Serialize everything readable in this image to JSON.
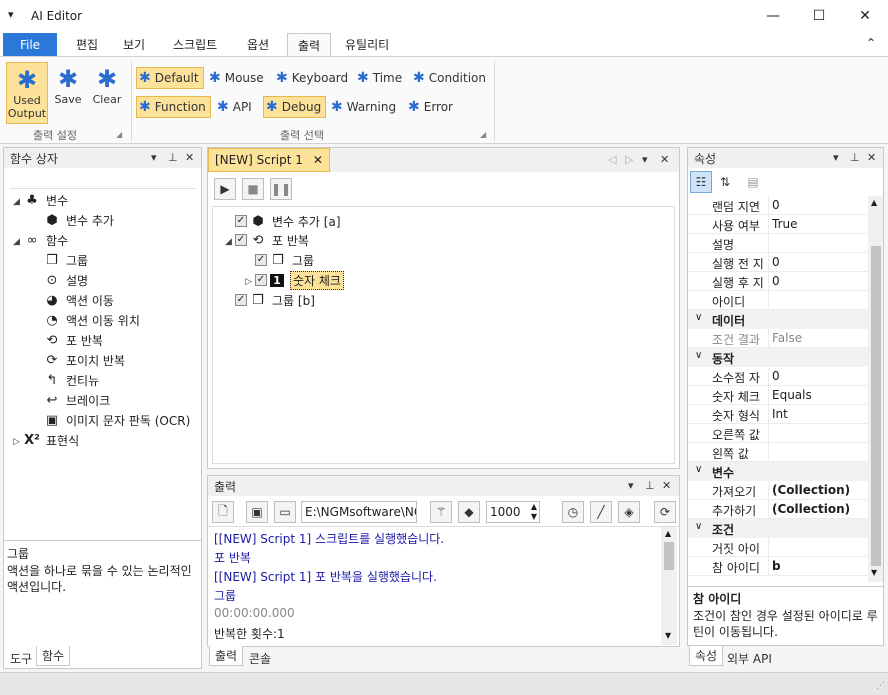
{
  "window": {
    "title": "AI Editor",
    "minimize": "—",
    "maximize": "☐",
    "close": "✕",
    "menu_glyph": "▾"
  },
  "menu": {
    "file": "File",
    "tabs": [
      "편집",
      "보기",
      "스크립트",
      "옵션",
      "출력",
      "유틸리티"
    ],
    "collapse": "⌃"
  },
  "ribbon": {
    "group1": {
      "label": "출력 설정",
      "buttons": [
        {
          "label1": "Used",
          "label2": "Output"
        },
        {
          "label": "Save"
        },
        {
          "label": "Clear"
        }
      ]
    },
    "group2": {
      "label": "출력 선택",
      "row1": [
        "Default",
        "Mouse",
        "Keyboard",
        "Time",
        "Condition"
      ],
      "row2": [
        "Function",
        "API",
        "Debug",
        "Warning",
        "Error"
      ]
    }
  },
  "left_panel": {
    "title": "함수 상자",
    "tree": [
      {
        "label": "변수",
        "icon": "variable-icon"
      },
      {
        "label": "변수 추가",
        "icon": "add-variable-icon"
      },
      {
        "label": "함수",
        "icon": "function-icon"
      },
      {
        "label": "그룹",
        "icon": "group-icon"
      },
      {
        "label": "설명",
        "icon": "comment-icon"
      },
      {
        "label": "액션 이동",
        "icon": "action-move-icon"
      },
      {
        "label": "액션 이동 위치",
        "icon": "action-location-icon"
      },
      {
        "label": "포 반복",
        "icon": "loop-icon"
      },
      {
        "label": "포이치 반복",
        "icon": "foreach-icon"
      },
      {
        "label": "컨티뉴",
        "icon": "continue-icon"
      },
      {
        "label": "브레이크",
        "icon": "break-icon"
      },
      {
        "label": "이미지 문자 판독 (OCR)",
        "icon": "ocr-icon"
      },
      {
        "label": "표현식",
        "icon": "expression-icon"
      }
    ],
    "desc_title": "그룹",
    "desc_text": "액션을 하나로 묶을 수 있는 논리적인 액션입니다.",
    "tabs": [
      "도구",
      "함수"
    ]
  },
  "script_panel": {
    "tab": "[NEW] Script 1",
    "items": [
      {
        "label": "변수 추가 [a]"
      },
      {
        "label": "포 반복"
      },
      {
        "label": "그룹"
      },
      {
        "label": "숫자 체크"
      },
      {
        "label": "그룹 [b]"
      }
    ]
  },
  "output_panel": {
    "title": "출력",
    "path": "E:\\NGMsoftware\\NG",
    "count": "1000",
    "lines": [
      {
        "text": "[[NEW] Script 1] 스크립트를 실행했습니다.",
        "color": "#1a1aa6"
      },
      {
        "text": "포 반복",
        "color": "#1a1aa6"
      },
      {
        "text": "[[NEW] Script 1] 포 반복을 실행했습니다.",
        "color": "#1a1aa6"
      },
      {
        "text": "그룹",
        "color": "#1a1aa6"
      },
      {
        "text": "00:00:00.000",
        "color": "#888888"
      },
      {
        "text": "반복한 횟수:1",
        "color": "#222222"
      }
    ],
    "tabs": [
      "출력",
      "콘솔"
    ]
  },
  "properties_panel": {
    "title": "속성",
    "rows": [
      {
        "kind": "prop",
        "key": "랜덤 지연",
        "value": "0"
      },
      {
        "kind": "prop",
        "key": "사용 여부",
        "value": "True"
      },
      {
        "kind": "prop",
        "key": "설명",
        "value": ""
      },
      {
        "kind": "prop",
        "key": "실행 전 지",
        "value": "0"
      },
      {
        "kind": "prop",
        "key": "실행 후 지",
        "value": "0"
      },
      {
        "kind": "prop",
        "key": "아이디",
        "value": ""
      },
      {
        "kind": "cat",
        "key": "데이터"
      },
      {
        "kind": "prop",
        "key": "조건 결과",
        "value": "False",
        "gray": true
      },
      {
        "kind": "cat",
        "key": "동작"
      },
      {
        "kind": "prop",
        "key": "소수점 자",
        "value": "0"
      },
      {
        "kind": "prop",
        "key": "숫자 체크",
        "value": "Equals"
      },
      {
        "kind": "prop",
        "key": "숫자 형식",
        "value": "Int"
      },
      {
        "kind": "prop",
        "key": "오른쪽 값",
        "value": ""
      },
      {
        "kind": "prop",
        "key": "왼쪽 값",
        "value": ""
      },
      {
        "kind": "cat",
        "key": "변수"
      },
      {
        "kind": "prop",
        "key": "가져오기",
        "value": "(Collection)",
        "bold": true
      },
      {
        "kind": "prop",
        "key": "추가하기",
        "value": "(Collection)",
        "bold": true
      },
      {
        "kind": "cat",
        "key": "조건"
      },
      {
        "kind": "prop",
        "key": "거짓 아이",
        "value": ""
      },
      {
        "kind": "prop",
        "key": "참 아이디",
        "value": "b",
        "bold": true
      }
    ],
    "desc_title": "참 아이디",
    "desc_text": "조건이 참인 경우 설정된 아이디로 루틴이 이동됩니다.",
    "tabs": [
      "속성",
      "외부 API"
    ]
  }
}
